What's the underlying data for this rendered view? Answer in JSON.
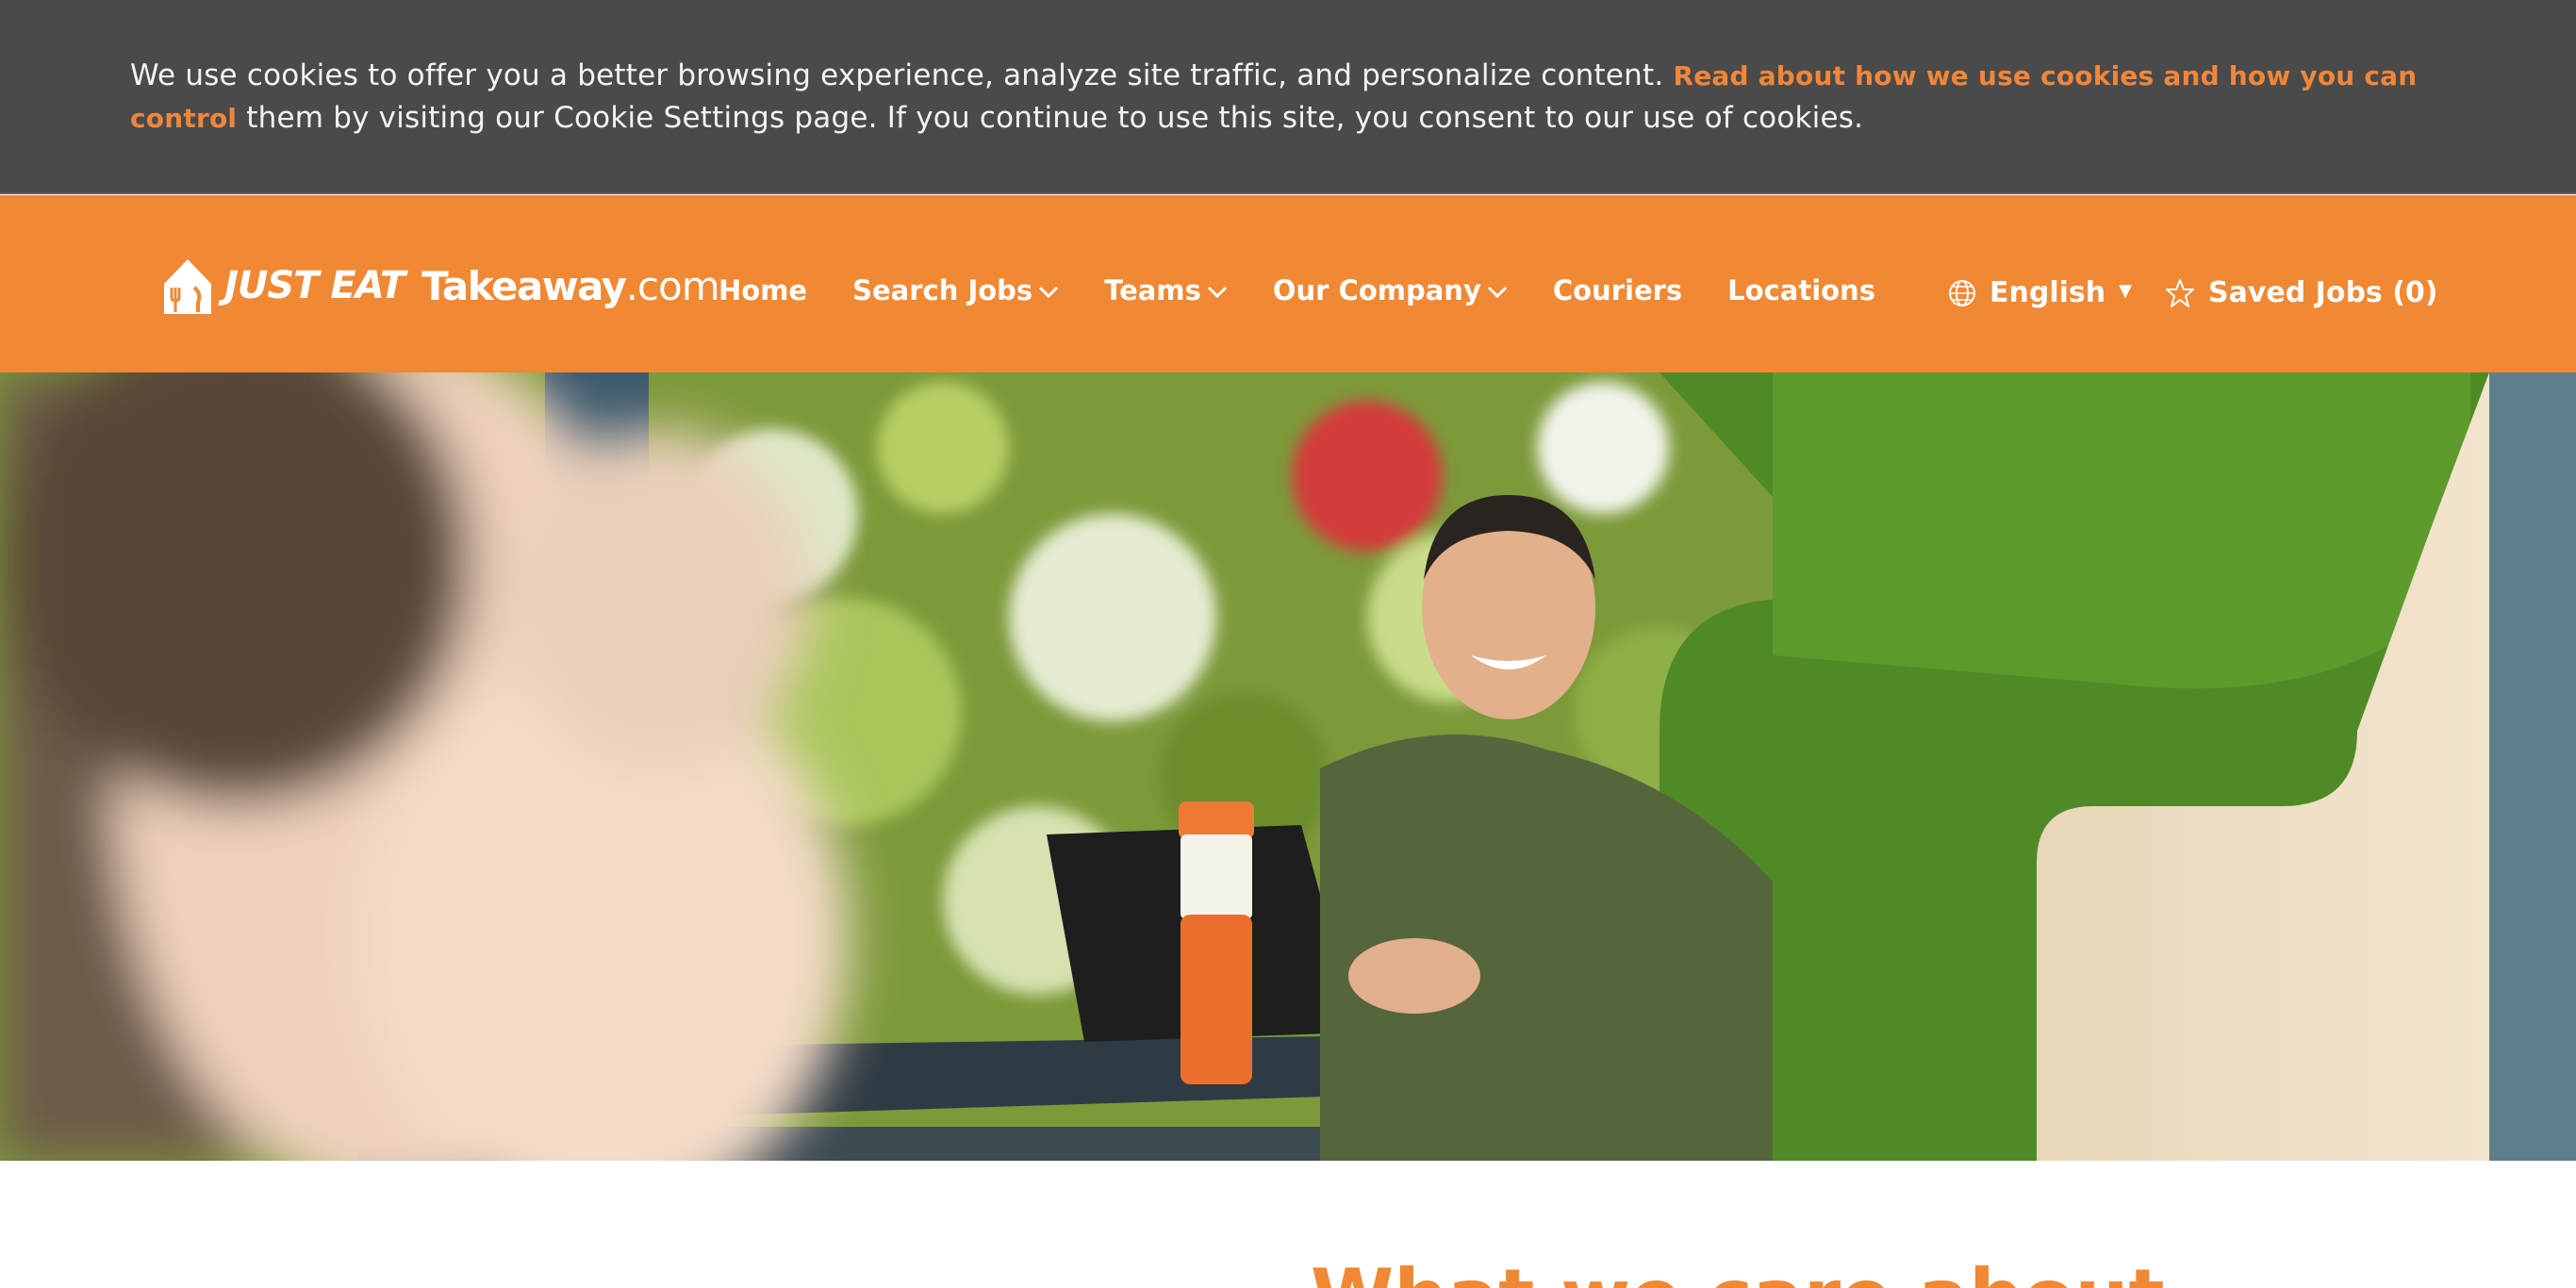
{
  "cookie_banner": {
    "text_before": "We use cookies to offer you a better browsing experience, analyze site traffic, and personalize content.",
    "link": "Read about how we use cookies and how you can control",
    "text_after": "them by visiting our Cookie Settings page. If you continue to use this site, you consent to our use of cookies."
  },
  "header": {
    "logo": {
      "just_eat": "JUST EAT",
      "takeaway": "Takeaway",
      "com": ".com"
    },
    "nav": [
      {
        "label": "Home",
        "dropdown": false
      },
      {
        "label": "Search Jobs",
        "dropdown": true
      },
      {
        "label": "Teams",
        "dropdown": true
      },
      {
        "label": "Our Company",
        "dropdown": true
      },
      {
        "label": "Couriers",
        "dropdown": false
      },
      {
        "label": "Locations",
        "dropdown": false
      }
    ],
    "language": "English",
    "saved_jobs": "Saved Jobs (0)"
  },
  "main": {
    "section_heading": "What we care about"
  },
  "colors": {
    "brand_orange": "#f08834",
    "cookie_bg": "#4a4a4a",
    "link_orange": "#f0863a"
  }
}
